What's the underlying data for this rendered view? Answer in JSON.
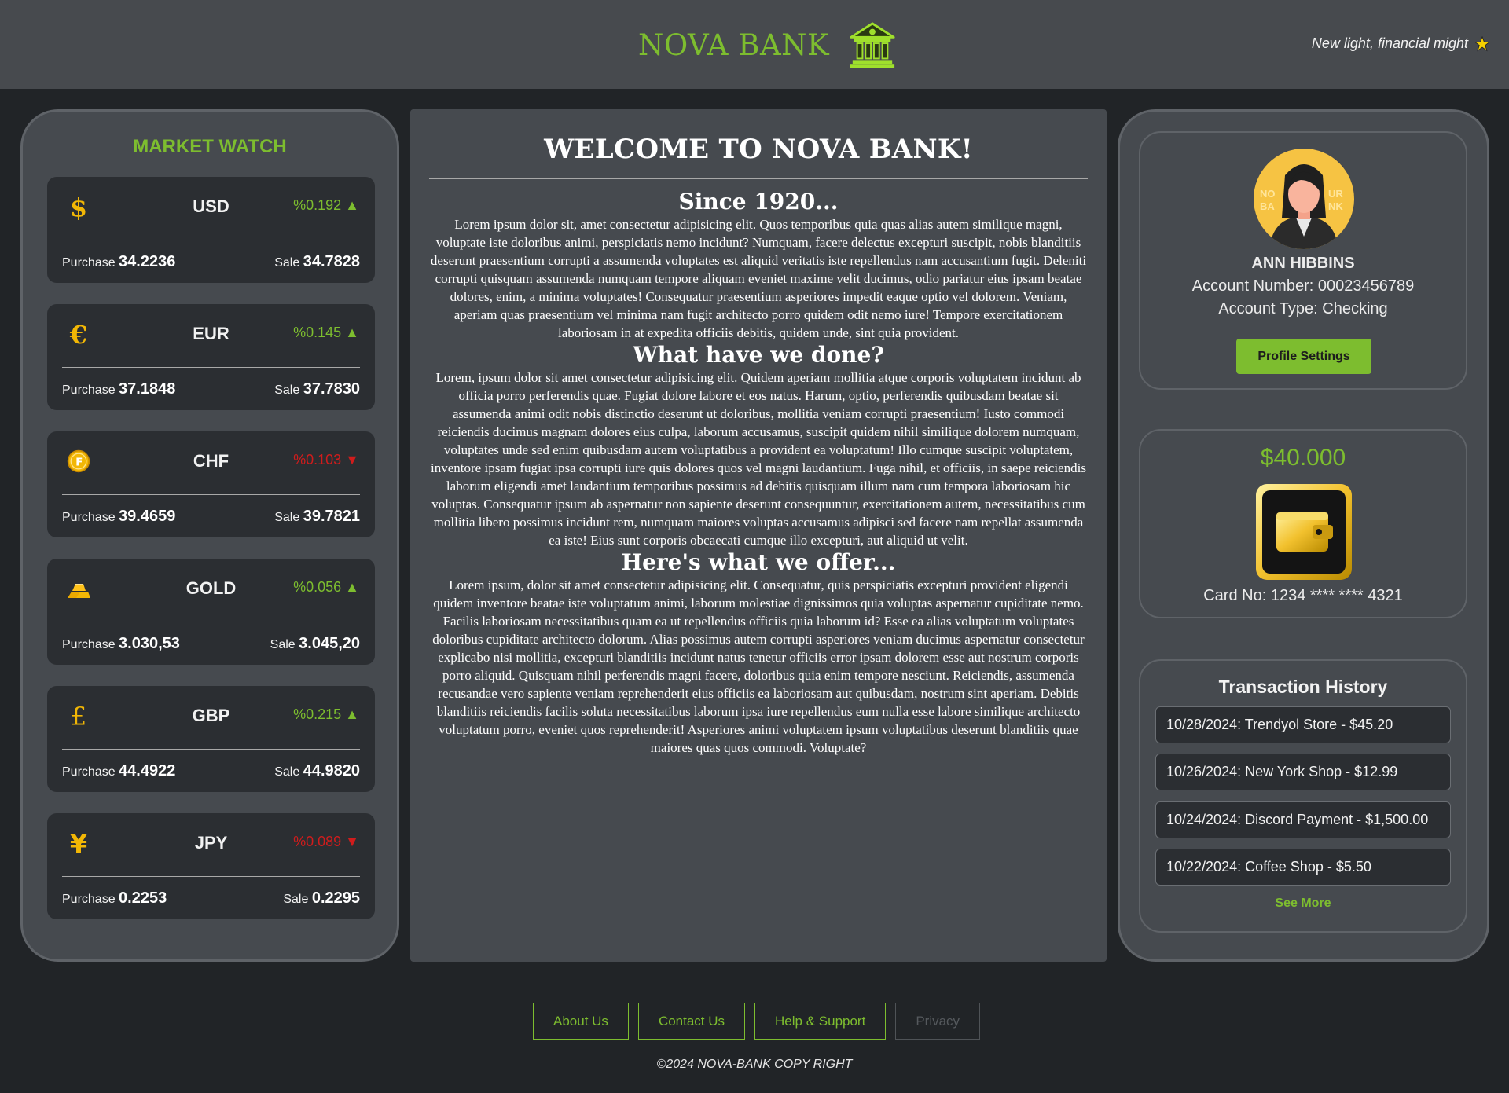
{
  "header": {
    "brand": "NOVA BANK",
    "tagline": "New light, financial might"
  },
  "market": {
    "title": "MARKET WATCH",
    "purchase_label": "Purchase",
    "sale_label": "Sale",
    "tickers": [
      {
        "code": "USD",
        "icon": "dollar-icon",
        "change": "%0.192 ▲",
        "direction": "up",
        "purchase": "34.2236",
        "sale": "34.7828"
      },
      {
        "code": "EUR",
        "icon": "euro-icon",
        "change": "%0.145 ▲",
        "direction": "up",
        "purchase": "37.1848",
        "sale": "37.7830"
      },
      {
        "code": "CHF",
        "icon": "franc-coin-icon",
        "change": "%0.103 ▼",
        "direction": "down",
        "purchase": "39.4659",
        "sale": "39.7821"
      },
      {
        "code": "GOLD",
        "icon": "gold-bars-icon",
        "change": "%0.056 ▲",
        "direction": "up",
        "purchase": "3.030,53",
        "sale": "3.045,20"
      },
      {
        "code": "GBP",
        "icon": "pound-icon",
        "change": "%0.215 ▲",
        "direction": "up",
        "purchase": "44.4922",
        "sale": "44.9820"
      },
      {
        "code": "JPY",
        "icon": "yen-icon",
        "change": "%0.089 ▼",
        "direction": "down",
        "purchase": "0.2253",
        "sale": "0.2295"
      }
    ]
  },
  "welcome": {
    "title": "WELCOME TO NOVA BANK!",
    "sections": [
      {
        "heading": "Since 1920...",
        "body": "Lorem ipsum dolor sit, amet consectetur adipisicing elit. Quos temporibus quia quas alias autem similique magni, voluptate iste doloribus animi, perspiciatis nemo incidunt? Numquam, facere delectus excepturi suscipit, nobis blanditiis deserunt praesentium corrupti a assumenda voluptates est aliquid veritatis iste repellendus nam accusantium fugit. Deleniti corrupti quisquam assumenda numquam tempore aliquam eveniet maxime velit ducimus, odio pariatur eius ipsam beatae dolores, enim, a minima voluptates! Consequatur praesentium asperiores impedit eaque optio vel dolorem. Veniam, aperiam quas praesentium vel minima nam fugit architecto porro quidem odit nemo iure! Tempore exercitationem laboriosam in at expedita officiis debitis, quidem unde, sint quia provident."
      },
      {
        "heading": "What have we done?",
        "body": "Lorem, ipsum dolor sit amet consectetur adipisicing elit. Quidem aperiam mollitia atque corporis voluptatem incidunt ab officia porro perferendis quae. Fugiat dolore labore et eos natus. Harum, optio, perferendis quibusdam beatae sit assumenda animi odit nobis distinctio deserunt ut doloribus, mollitia veniam corrupti praesentium! Iusto commodi reiciendis ducimus magnam dolores eius culpa, laborum accusamus, suscipit quidem nihil similique dolorem numquam, voluptates unde sed enim quibusdam autem voluptatibus a provident ea voluptatum! Illo cumque suscipit voluptatem, inventore ipsam fugiat ipsa corrupti iure quis dolores quos vel magni laudantium. Fuga nihil, et officiis, in saepe reiciendis laborum eligendi amet laudantium temporibus possimus ad debitis quisquam illum nam cum tempora laboriosam hic voluptas. Consequatur ipsum ab aspernatur non sapiente deserunt consequuntur, exercitationem autem, necessitatibus cum mollitia libero possimus incidunt rem, numquam maiores voluptas accusamus adipisci sed facere nam repellat assumenda ea iste! Eius sunt corporis obcaecati cumque illo excepturi, aut aliquid ut velit."
      },
      {
        "heading": "Here's what we offer...",
        "body": "Lorem ipsum, dolor sit amet consectetur adipisicing elit. Consequatur, quis perspiciatis excepturi provident eligendi quidem inventore beatae iste voluptatum animi, laborum molestiae dignissimos quia voluptas aspernatur cupiditate nemo. Facilis laboriosam necessitatibus quam ea ut repellendus officiis quia laborum id? Esse ea alias voluptatum voluptates doloribus cupiditate architecto dolorum. Alias possimus autem corrupti asperiores veniam ducimus aspernatur consectetur explicabo nisi mollitia, excepturi blanditiis incidunt natus tenetur officiis error ipsam dolorem esse aut nostrum corporis porro aliquid. Quisquam nihil perferendis magni facere, doloribus quia enim tempore nesciunt. Reiciendis, assumenda recusandae vero sapiente veniam reprehenderit eius officiis ea laboriosam aut quibusdam, nostrum sint aperiam. Debitis blanditiis reiciendis facilis soluta necessitatibus laborum ipsa iure repellendus eum nulla esse labore similique architecto voluptatum porro, eveniet quos reprehenderit! Asperiores animi voluptatem ipsum voluptatibus deserunt blanditiis quae maiores quas quos commodi. Voluptate?"
      }
    ]
  },
  "profile": {
    "name": "ANN HIBBINS",
    "account_number": "Account Number: 00023456789",
    "account_type": "Account Type: Checking",
    "settings_label": "Profile Settings"
  },
  "balance": {
    "amount": "$40.000",
    "card_no": "Card No: 1234 **** **** 4321"
  },
  "history": {
    "title": "Transaction History",
    "items": [
      "10/28/2024: Trendyol Store - $45.20",
      "10/26/2024: New York Shop - $12.99",
      "10/24/2024: Discord Payment - $1,500.00",
      "10/22/2024: Coffee Shop - $5.50"
    ],
    "see_more": "See More"
  },
  "footer": {
    "links": [
      "About Us",
      "Contact Us",
      "Help & Support",
      "Privacy"
    ],
    "copyright": "©2024 NOVA-BANK COPY RIGHT"
  },
  "colors": {
    "accent": "#7dbd2f",
    "up": "#7dbd2f",
    "down": "#d01c1c",
    "background": "#212427",
    "panel": "#464a4f"
  }
}
